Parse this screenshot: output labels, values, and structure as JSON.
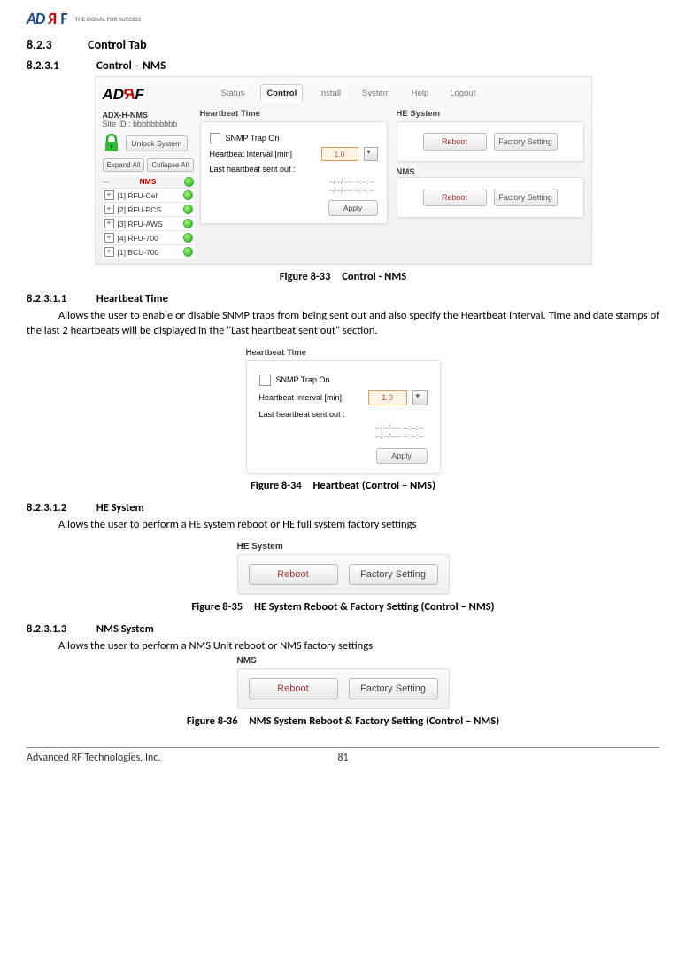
{
  "header": {
    "logo_text_ad": "AD",
    "logo_text_r": "R",
    "logo_text_f": "F",
    "slogan": "THE SIGNAL FOR SUCCESS"
  },
  "headings": {
    "s823_num": "8.2.3",
    "s823_title": "Control Tab",
    "s8231_num": "8.2.3.1",
    "s8231_title": "Control – NMS",
    "s82311_num": "8.2.3.1.1",
    "s82311_title": "Heartbeat Time",
    "s82312_num": "8.2.3.1.2",
    "s82312_title": "HE System",
    "s82313_num": "8.2.3.1.3",
    "s82313_title": "NMS System"
  },
  "paragraphs": {
    "heartbeat": "Allows the user to enable or disable SNMP traps from being sent out and also specify the Heartbeat interval. Time and date stamps of the last 2 heartbeats will be displayed in the \"Last heartbeat sent out\" section.",
    "he_system": "Allows the user to perform a HE system reboot or HE full system factory settings",
    "nms_system": "Allows the user to perform a NMS Unit reboot or NMS factory settings"
  },
  "captions": {
    "fig33_num": "Figure 8-33",
    "fig33_title": "Control - NMS",
    "fig34_num": "Figure 8-34",
    "fig34_title": "Heartbeat (Control – NMS)",
    "fig35_num": "Figure 8-35",
    "fig35_title": "HE System Reboot & Factory Setting (Control – NMS)",
    "fig36_num": "Figure 8-36",
    "fig36_title": "NMS System Reboot & Factory Setting (Control – NMS)"
  },
  "control_panel": {
    "model": "ADX-H-NMS",
    "site_id_label": "Site ID :",
    "site_id_value": "bbbbbbbbbb",
    "unlock_button": "Unlock System",
    "expand_all": "Expand All",
    "collapse_all": "Collapse AII",
    "tree_root": "NMS",
    "tree_items": [
      "[1] RFU-Cell",
      "[2] RFU-PCS",
      "[3] RFU-AWS",
      "[4] RFU-700",
      "[1] BCU-700"
    ],
    "tabs": [
      "Status",
      "Control",
      "Install",
      "System",
      "Help",
      "Logout"
    ],
    "active_tab_index": 1,
    "heartbeat_section": "Heartbeat Time",
    "snmp_label": "SNMP Trap On",
    "interval_label": "Heartbeat Interval [min]",
    "interval_value": "1.0",
    "last_sent_label": "Last heartbeat sent out :",
    "ts1": "--/--/---- --:--:--",
    "ts2": "--/--/---- --:--:--",
    "apply": "Apply",
    "he_section": "HE System",
    "nms_section": "NMS",
    "reboot": "Reboot",
    "factory": "Factory Setting"
  },
  "heartbeat_panel": {
    "title": "Heartbeat Time",
    "snmp_label": "SNMP Trap On",
    "interval_label": "Heartbeat Interval [min]",
    "interval_value": "1.0",
    "last_sent_label": "Last heartbeat sent out :",
    "ts1": "--/--/---- --:--:--",
    "ts2": "--/--/---- --:--:--",
    "apply": "Apply"
  },
  "he_panel": {
    "title": "HE System",
    "reboot": "Reboot",
    "factory": "Factory Setting"
  },
  "nms_panel": {
    "title": "NMS",
    "reboot": "Reboot",
    "factory": "Factory Setting"
  },
  "footer": {
    "company": "Advanced RF Technologies, Inc.",
    "page": "81"
  }
}
